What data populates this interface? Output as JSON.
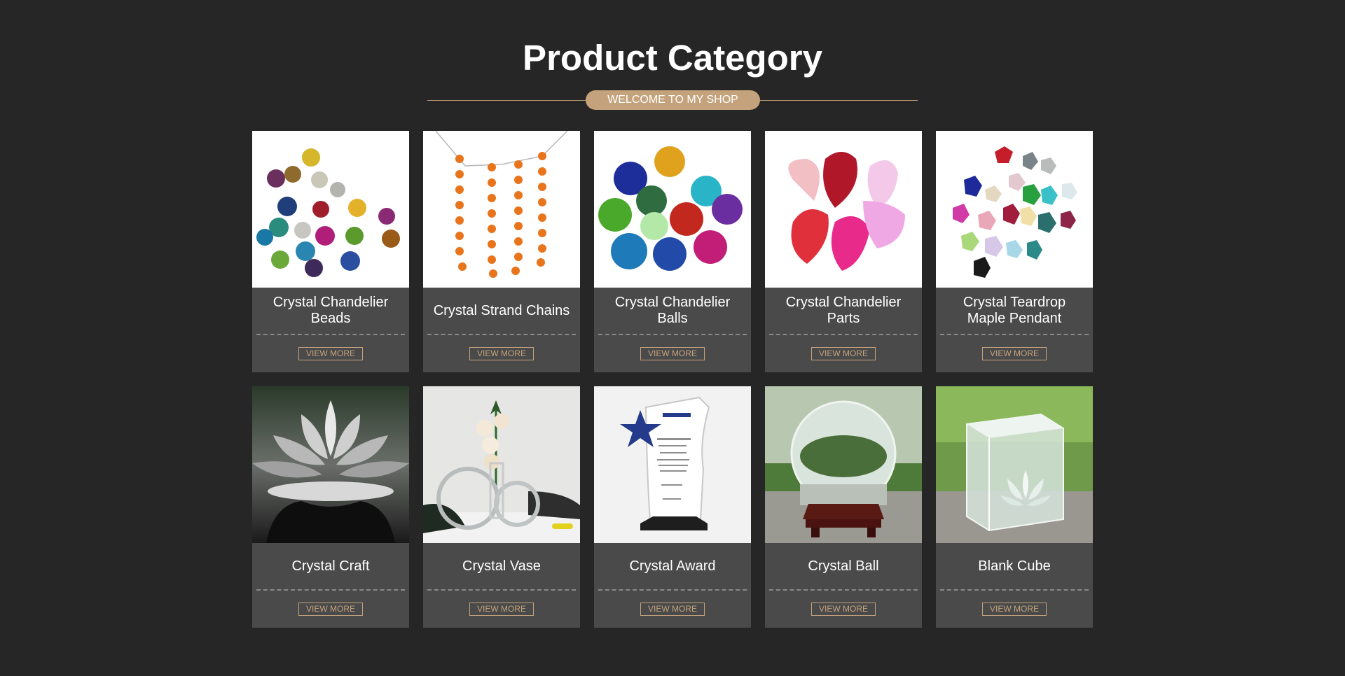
{
  "header": {
    "title": "Product Category",
    "tagline": "WELCOME TO MY SHOP"
  },
  "colors": {
    "background": "#262626",
    "card": "#4a4a4a",
    "accent": "#c4a27c"
  },
  "categories": [
    {
      "name": "Crystal Chandelier Beads",
      "button": "VIEW MORE",
      "image": "colorful-octagon-beads"
    },
    {
      "name": "Crystal Strand Chains",
      "button": "VIEW MORE",
      "image": "orange-bead-strands"
    },
    {
      "name": "Crystal Chandelier Balls",
      "button": "VIEW MORE",
      "image": "faceted-crystal-balls"
    },
    {
      "name": "Crystal Chandelier Parts",
      "button": "VIEW MORE",
      "image": "teardrop-prisms"
    },
    {
      "name": "Crystal Teardrop Maple Pendant",
      "button": "VIEW MORE",
      "image": "maple-leaf-pendants"
    },
    {
      "name": "Crystal Craft",
      "button": "VIEW MORE",
      "image": "crystal-lotus"
    },
    {
      "name": "Crystal Vase",
      "button": "VIEW MORE",
      "image": "ring-vase-with-flowers"
    },
    {
      "name": "Crystal Award",
      "button": "VIEW MORE",
      "image": "star-award-plaque"
    },
    {
      "name": "Crystal Ball",
      "button": "VIEW MORE",
      "image": "crystal-ball-on-stand"
    },
    {
      "name": "Blank Cube",
      "button": "VIEW MORE",
      "image": "cube-with-lotus"
    }
  ]
}
